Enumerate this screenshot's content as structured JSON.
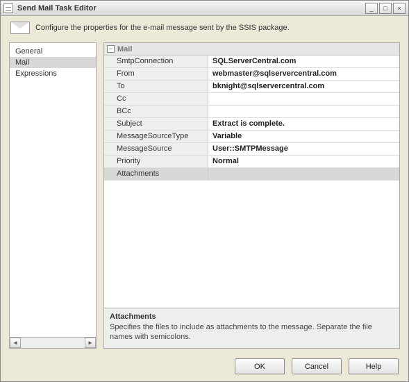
{
  "window": {
    "title": "Send Mail Task Editor"
  },
  "description": "Configure the properties for the e-mail message sent by the SSIS package.",
  "nav": {
    "items": [
      {
        "label": "General",
        "selected": false
      },
      {
        "label": "Mail",
        "selected": true
      },
      {
        "label": "Expressions",
        "selected": false
      }
    ]
  },
  "grid": {
    "category": "Mail",
    "properties": [
      {
        "name": "SmtpConnection",
        "value": "SQLServerCentral.com"
      },
      {
        "name": "From",
        "value": "webmaster@sqlservercentral.com"
      },
      {
        "name": "To",
        "value": "bknight@sqlservercentral.com"
      },
      {
        "name": "Cc",
        "value": ""
      },
      {
        "name": "BCc",
        "value": ""
      },
      {
        "name": "Subject",
        "value": "Extract is complete."
      },
      {
        "name": "MessageSourceType",
        "value": "Variable"
      },
      {
        "name": "MessageSource",
        "value": "User::SMTPMessage"
      },
      {
        "name": "Priority",
        "value": "Normal"
      },
      {
        "name": "Attachments",
        "value": ""
      }
    ]
  },
  "help": {
    "title": "Attachments",
    "text": "Specifies the files to include as attachments to the message. Separate the file names with semicolons."
  },
  "buttons": {
    "ok": "OK",
    "cancel": "Cancel",
    "help": "Help"
  },
  "controls": {
    "collapse": "−",
    "scroll_left": "◄",
    "scroll_right": "►",
    "min": "_",
    "max": "□",
    "close": "×"
  }
}
